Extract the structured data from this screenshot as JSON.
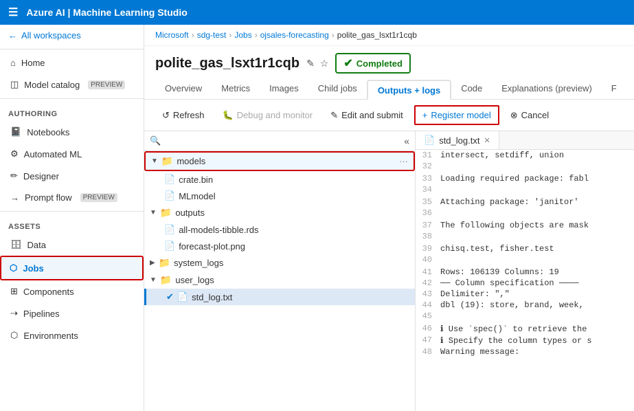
{
  "topbar": {
    "title": "Azure AI | Machine Learning Studio"
  },
  "breadcrumb": {
    "items": [
      "Microsoft",
      "sdg-test",
      "Jobs",
      "ojsales-forecasting",
      "polite_gas_lsxt1r1cqb"
    ]
  },
  "job": {
    "title": "polite_gas_lsxt1r1cqb",
    "status": "Completed"
  },
  "tabs": [
    {
      "label": "Overview"
    },
    {
      "label": "Metrics"
    },
    {
      "label": "Images"
    },
    {
      "label": "Child jobs"
    },
    {
      "label": "Outputs + logs"
    },
    {
      "label": "Code"
    },
    {
      "label": "Explanations (preview)"
    },
    {
      "label": "F"
    }
  ],
  "toolbar": {
    "refresh": "Refresh",
    "debug": "Debug and monitor",
    "edit": "Edit and submit",
    "register": "Register model",
    "cancel": "Cancel"
  },
  "sidebar": {
    "all_workspaces": "All workspaces",
    "home": "Home",
    "model_catalog": "Model catalog",
    "authoring_label": "Authoring",
    "notebooks": "Notebooks",
    "automated_ml": "Automated ML",
    "designer": "Designer",
    "prompt_flow": "Prompt flow",
    "assets_label": "Assets",
    "data": "Data",
    "jobs": "Jobs",
    "components": "Components",
    "pipelines": "Pipelines",
    "environments": "Environments",
    "preview_badge": "PREVIEW"
  },
  "files": [
    {
      "level": 0,
      "type": "folder-open",
      "name": "models",
      "hasMenu": true,
      "highlighted": true
    },
    {
      "level": 1,
      "type": "file",
      "name": "crate.bin"
    },
    {
      "level": 1,
      "type": "file",
      "name": "MLmodel"
    },
    {
      "level": 0,
      "type": "folder-open",
      "name": "outputs"
    },
    {
      "level": 1,
      "type": "file",
      "name": "all-models-tibble.rds"
    },
    {
      "level": 1,
      "type": "file",
      "name": "forecast-plot.png"
    },
    {
      "level": 0,
      "type": "folder-collapsed",
      "name": "system_logs"
    },
    {
      "level": 0,
      "type": "folder-open",
      "name": "user_logs"
    },
    {
      "level": 1,
      "type": "file-selected",
      "name": "std_log.txt"
    }
  ],
  "code_tab": {
    "filename": "std_log.txt"
  },
  "code_lines": [
    {
      "num": 31,
      "text": "    intersect, setdiff, union"
    },
    {
      "num": 32,
      "text": ""
    },
    {
      "num": 33,
      "text": "Loading required package: fabl"
    },
    {
      "num": 34,
      "text": ""
    },
    {
      "num": 35,
      "text": "Attaching package: 'janitor'"
    },
    {
      "num": 36,
      "text": ""
    },
    {
      "num": 37,
      "text": "The following objects are mask"
    },
    {
      "num": 38,
      "text": ""
    },
    {
      "num": 39,
      "text": "    chisq.test, fisher.test"
    },
    {
      "num": 40,
      "text": ""
    },
    {
      "num": 41,
      "text": "Rows: 106139 Columns: 19"
    },
    {
      "num": 42,
      "text": "── Column specification ────"
    },
    {
      "num": 43,
      "text": "Delimiter: \",\""
    },
    {
      "num": 44,
      "text": "dbl (19): store, brand, week,"
    },
    {
      "num": 45,
      "text": ""
    },
    {
      "num": 46,
      "text": "ℹ Use `spec()` to retrieve the"
    },
    {
      "num": 47,
      "text": "ℹ Specify the column types or s"
    },
    {
      "num": 48,
      "text": "Warning message:"
    }
  ]
}
